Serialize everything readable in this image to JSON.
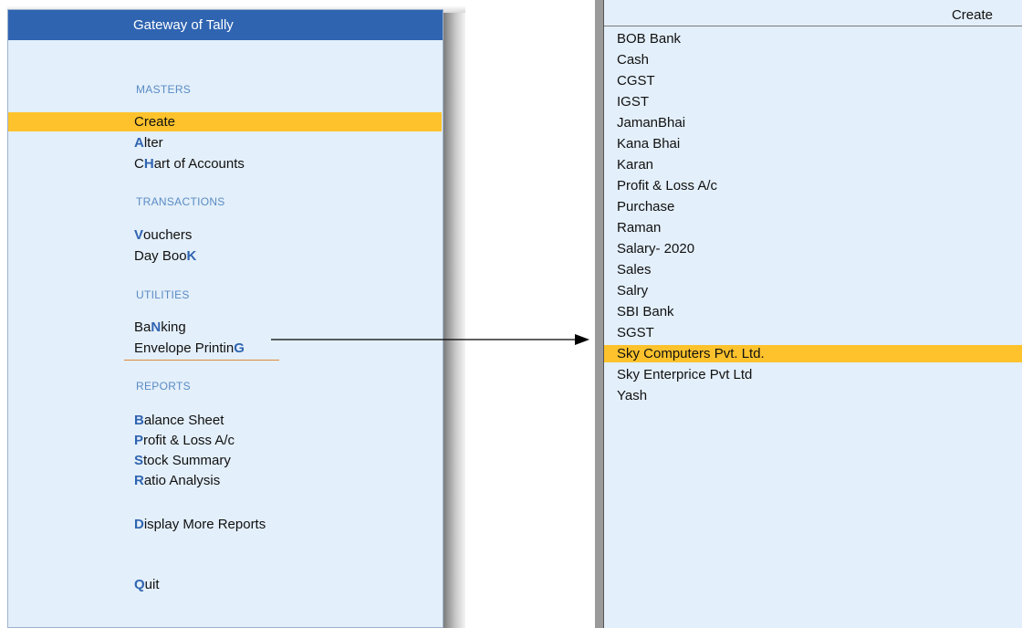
{
  "gateway": {
    "title": "Gateway of Tally",
    "sections": {
      "masters": "MASTERS",
      "transactions": "TRANSACTIONS",
      "utilities": "UTILITIES",
      "reports": "REPORTS"
    },
    "items": {
      "create": {
        "pre": "",
        "hot": "",
        "post": "Create"
      },
      "alter": {
        "pre": "",
        "hot": "A",
        "post": "lter"
      },
      "chart": {
        "pre": "C",
        "hot": "H",
        "post": "art of Accounts"
      },
      "vouchers": {
        "pre": "",
        "hot": "V",
        "post": "ouchers"
      },
      "daybook": {
        "pre": "Day Boo",
        "hot": "K",
        "post": ""
      },
      "banking": {
        "pre": "Ba",
        "hot": "N",
        "post": "king"
      },
      "envelope": {
        "pre": "Envelope Printin",
        "hot": "G",
        "post": ""
      },
      "balance": {
        "pre": "",
        "hot": "B",
        "post": "alance Sheet"
      },
      "profit": {
        "pre": "",
        "hot": "P",
        "post": "rofit & Loss A/c"
      },
      "stock": {
        "pre": "",
        "hot": "S",
        "post": "tock Summary"
      },
      "ratio": {
        "pre": "",
        "hot": "R",
        "post": "atio Analysis"
      },
      "display": {
        "pre": "",
        "hot": "D",
        "post": "isplay More Reports"
      },
      "quit": {
        "pre": "",
        "hot": "Q",
        "post": "uit"
      }
    },
    "selected": "Create"
  },
  "ledger_list": {
    "header": "Create",
    "items": [
      "BOB Bank",
      "Cash",
      "CGST",
      "IGST",
      "JamanBhai",
      "Kana Bhai",
      "Karan",
      "Profit & Loss A/c",
      "Purchase",
      "Raman",
      "Salary- 2020",
      "Sales",
      "Salry",
      "SBI Bank",
      "SGST",
      "Sky Computers Pvt. Ltd.",
      "Sky Enterprice Pvt Ltd",
      "Yash"
    ],
    "selected": "Sky Computers Pvt. Ltd."
  },
  "colors": {
    "panel_bg": "#e3effa",
    "title_bar": "#2f64b1",
    "highlight": "#fdc22c",
    "hotkey": "#2f64b1",
    "section": "#5a8bc4"
  }
}
